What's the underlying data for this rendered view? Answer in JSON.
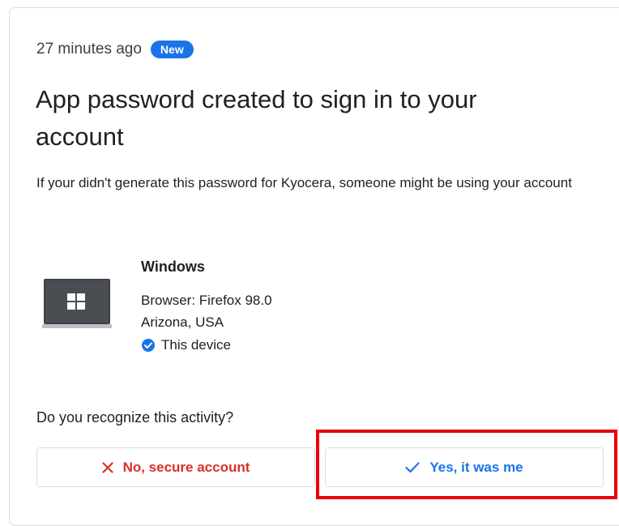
{
  "activity": {
    "time": "27 minutes ago",
    "badge": "New",
    "title": "App password created to sign in to your account",
    "description": "If your didn't generate this password for Kyocera, someone might be using your account"
  },
  "device": {
    "icon": "windows-laptop-icon",
    "name": "Windows",
    "browser": "Browser: Firefox 98.0",
    "location": "Arizona, USA",
    "this_device": "This device"
  },
  "question": "Do you recognize this activity?",
  "buttons": {
    "no_label": "No, secure account",
    "yes_label": "Yes, it was me"
  },
  "colors": {
    "accent": "#1a73e8",
    "danger": "#d93025",
    "highlight": "#e8000c"
  }
}
